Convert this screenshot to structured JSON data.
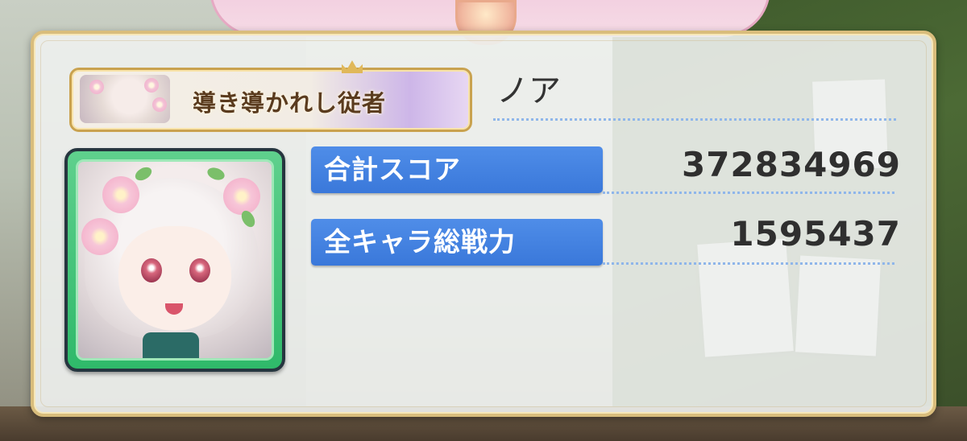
{
  "profile": {
    "title": "導き導かれし従者",
    "player_name": "ノア"
  },
  "stats": [
    {
      "label": "合計スコア",
      "value": "372834969"
    },
    {
      "label": "全キャラ総戦力",
      "value": "1595437"
    }
  ],
  "colors": {
    "panel_border": "#d9bd7c",
    "label_blue": "#3a78da",
    "avatar_frame": "#2fb96a",
    "dotted_line": "#8fb6ea"
  },
  "icons": {
    "title_thumbnail": "character-thumbnail",
    "avatar": "character-portrait"
  }
}
